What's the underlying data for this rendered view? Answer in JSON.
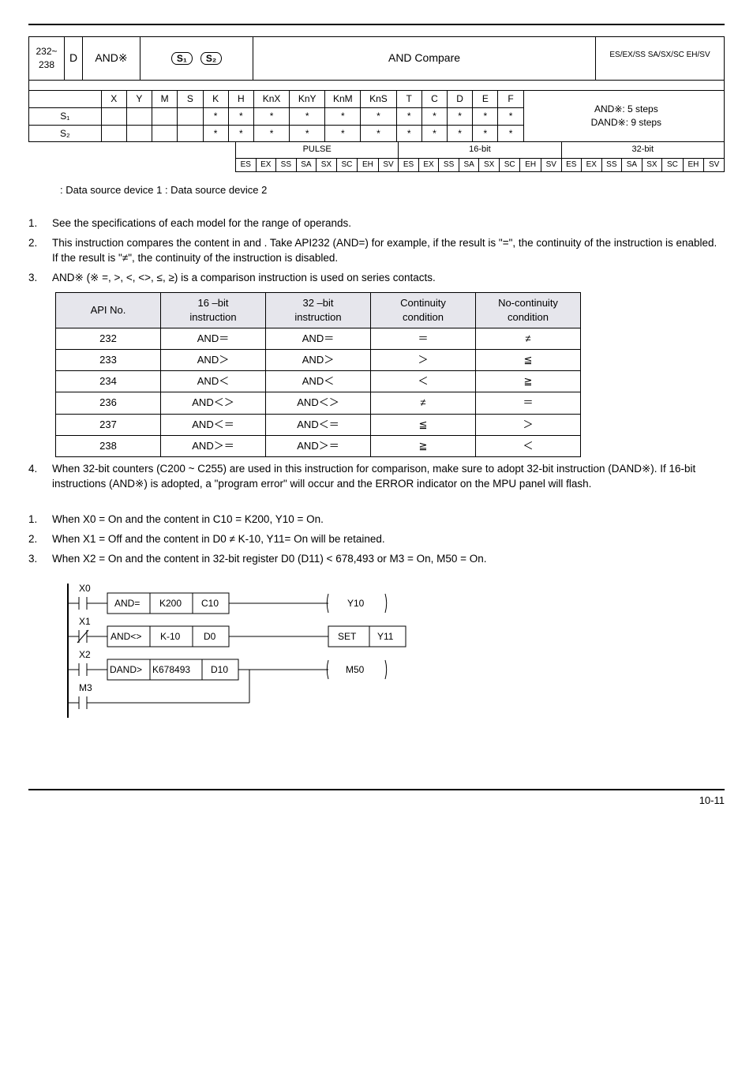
{
  "top": {
    "api_col": "232~\n238",
    "d_col": "D",
    "mnemonic": "AND※",
    "operands_s1": "S₁",
    "operands_s2": "S₂",
    "function": "AND Compare",
    "controllers": "ES/EX/SS SA/SX/SC EH/SV",
    "type_header": {
      "X": "X",
      "Y": "Y",
      "M": "M",
      "S": "S",
      "K": "K",
      "H": "H",
      "KnX": "KnX",
      "KnY": "KnY",
      "KnM": "KnM",
      "KnS": "KnS",
      "T": "T",
      "C": "C",
      "D": "D",
      "E": "E",
      "F": "F"
    },
    "row_s1": "S₁",
    "row_s2": "S₂",
    "steps1": "AND※: 5 steps",
    "steps2": "DAND※: 9 steps",
    "bits": {
      "pulse": "PULSE",
      "b16": "16-bit",
      "b32": "32-bit"
    },
    "strip_cells": [
      "ES",
      "EX",
      "SS",
      "SA",
      "SX",
      "SC",
      "EH",
      "SV",
      "ES",
      "EX",
      "SS",
      "SA",
      "SX",
      "SC",
      "EH",
      "SV",
      "ES",
      "EX",
      "SS",
      "SA",
      "SX",
      "SC",
      "EH",
      "SV"
    ]
  },
  "legend": ": Data source device 1       : Data source device 2",
  "expl": {
    "i1": "See the specifications of each model for the range of operands.",
    "i2": "This instruction compares the content in     and    . Take API232 (AND=) for example, if the result is \"=\", the continuity of the instruction is enabled. If the result is \"≠\", the continuity of the instruction is disabled.",
    "i3": "AND※ (※ =, >, <, <>, ≤, ≥) is a comparison instruction is used on series contacts.",
    "i4": "When 32-bit counters (C200 ~ C255) are used in this instruction for comparison, make sure to adopt 32-bit instruction (DAND※). If 16-bit instructions (AND※) is adopted, a \"program error\" will occur and the ERROR indicator on the MPU panel will flash."
  },
  "cmp": {
    "hdr": {
      "api": "API No.",
      "b16": "16 –bit\ninstruction",
      "b32": "32 –bit\ninstruction",
      "cc": "Continuity\ncondition",
      "nc": "No-continuity\ncondition"
    },
    "rows": [
      {
        "n": "232",
        "a": "AND＝",
        "b": "AND＝",
        "c": "＝",
        "d": "≠"
      },
      {
        "n": "233",
        "a": "AND＞",
        "b": "AND＞",
        "c": "＞",
        "d": "≦"
      },
      {
        "n": "234",
        "a": "AND＜",
        "b": "AND＜",
        "c": "＜",
        "d": "≧"
      },
      {
        "n": "236",
        "a": "AND＜＞",
        "b": "AND＜＞",
        "c": "≠",
        "d": "＝"
      },
      {
        "n": "237",
        "a": "AND＜＝",
        "b": "AND＜＝",
        "c": "≦",
        "d": "＞"
      },
      {
        "n": "238",
        "a": "AND＞＝",
        "b": "AND＞＝",
        "c": "≧",
        "d": "＜"
      }
    ]
  },
  "prog": {
    "p1": "When X0 = On and the content in C10 = K200, Y10 = On.",
    "p2": "When X1 = Off and the content in D0 ≠ K-10, Y11= On will be retained.",
    "p3": "When X2 = On and the content in 32-bit register D0 (D11) < 678,493 or M3 = On, M50 = On."
  },
  "ladder": {
    "x0": "X0",
    "x1": "X1",
    "x2": "X2",
    "m3": "M3",
    "and_eq": "AND=",
    "and_ne": "AND<>",
    "dand_gt": "DAND>",
    "k200": "K200",
    "k_10": "K-10",
    "k678493": "K678493",
    "c10": "C10",
    "d0": "D0",
    "d10": "D10",
    "y10": "Y10",
    "set": "SET",
    "y11": "Y11",
    "m50": "M50"
  },
  "pagenum": "10-11"
}
